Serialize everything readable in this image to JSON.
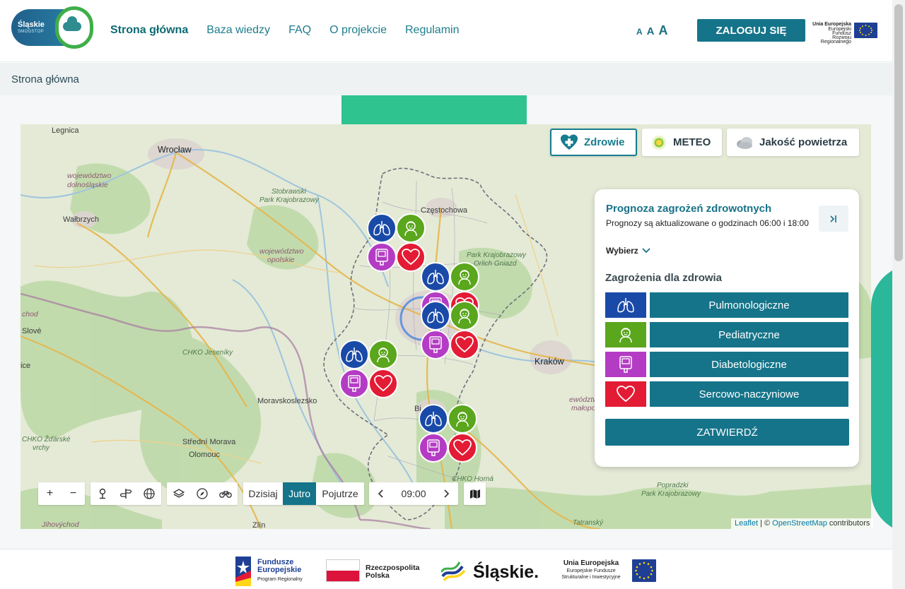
{
  "header": {
    "logo": {
      "line1": "Śląskie",
      "line2": "SMOGSTOP"
    },
    "nav": [
      {
        "label": "Strona główna",
        "active": true
      },
      {
        "label": "Baza wiedzy",
        "active": false
      },
      {
        "label": "FAQ",
        "active": false
      },
      {
        "label": "O projekcie",
        "active": false
      },
      {
        "label": "Regulamin",
        "active": false
      }
    ],
    "font_size_labels": [
      "A",
      "A",
      "A"
    ],
    "login_label": "ZALOGUJ SIĘ",
    "eu_logo": {
      "title": "Unia Europejska",
      "sub1": "Europejski Fundusz",
      "sub2": "Rozwoju Regionalnego"
    }
  },
  "breadcrumb": "Strona główna",
  "map": {
    "layer_tabs": [
      {
        "label": "Zdrowie",
        "icon": "heart-plus-icon",
        "active": true
      },
      {
        "label": "METEO",
        "icon": "sun-icon",
        "active": false
      },
      {
        "label": "Jakość powietrza",
        "icon": "cloud-icon",
        "active": false
      }
    ],
    "labels": {
      "legnica": "Legnica",
      "wroclaw": "Wrocław",
      "walbrzych": "Wałbrzych",
      "woj_dolnoslaskie_1": "województwo",
      "woj_dolnoslaskie_2": "dolnośląskie",
      "woj_opolskie_1": "województwo",
      "woj_opolskie_2": "opolskie",
      "stobrawski_1": "Stobrawski",
      "stobrawski_2": "Park Krajobrazowy",
      "czestochowa": "Częstochowa",
      "orlich_1": "Park Krajobrazowy",
      "orlich_2": "Orlich Gniazd",
      "krakow": "Kraków",
      "jeseniky": "CHKO Jeseníky",
      "moravskoslezsko": "Moravskoslezsko",
      "zdarske_1": "CHKO Žďárské",
      "zdarske_2": "vrchy",
      "stredni_morava": "Střední Morava",
      "olomouc": "Olomouc",
      "chod": "chod",
      "slove": "Slové",
      "ice": "ice",
      "jihovychod": "Jihovýchod",
      "zlin": "Zlín",
      "poprad_1": "Popradzki",
      "poprad_2": "Park Krajobrazowy",
      "tatransky": "Tatranský",
      "malopo_1": "ewództwo",
      "malopo_2": "małopo",
      "chko_horna": "CHKO Horná",
      "bielsko": "Bi"
    },
    "controls": {
      "zoom_in": "+",
      "zoom_out": "−",
      "days": [
        {
          "label": "Dzisiaj",
          "selected": false
        },
        {
          "label": "Jutro",
          "selected": true
        },
        {
          "label": "Pojutrze",
          "selected": false
        }
      ],
      "time": "09:00"
    },
    "attribution": {
      "leaflet": "Leaflet",
      "sep": " | © ",
      "osm": "OpenStreetMap",
      "rest": " contributors"
    }
  },
  "panel": {
    "title": "Prognoza zagrożeń zdrowotnych",
    "subtitle": "Prognozy są aktualizowane o godzinach 06:00 i 18:00",
    "select_label": "Wybierz",
    "section_title": "Zagrożenia dla zdrowia",
    "categories": [
      {
        "label": "Pulmonologiczne",
        "icon": "lungs-icon",
        "color": "#1a4aa8"
      },
      {
        "label": "Pediatryczne",
        "icon": "child-icon",
        "color": "#5aa61c"
      },
      {
        "label": "Diabetologiczne",
        "icon": "glucometer-icon",
        "color": "#b43cc4"
      },
      {
        "label": "Sercowo-naczyniowe",
        "icon": "heart-icon",
        "color": "#e31b34"
      }
    ],
    "confirm_label": "ZATWIERDŹ"
  },
  "footer": {
    "fe": {
      "line1": "Fundusze",
      "line2": "Europejskie",
      "line3": "Program Regionalny"
    },
    "rp": {
      "line1": "Rzeczpospolita",
      "line2": "Polska"
    },
    "slaskie": "Śląskie.",
    "eu": {
      "line1": "Unia Europejska",
      "line2": "Europejskie Fundusze",
      "line3": "Strukturalne i Inwestycyjne"
    }
  },
  "colors": {
    "accent": "#157489",
    "nav": "#1e7e8c",
    "lung": "#1a4aa8",
    "child": "#5aa61c",
    "diabetes": "#b43cc4",
    "heart": "#e31b34"
  }
}
